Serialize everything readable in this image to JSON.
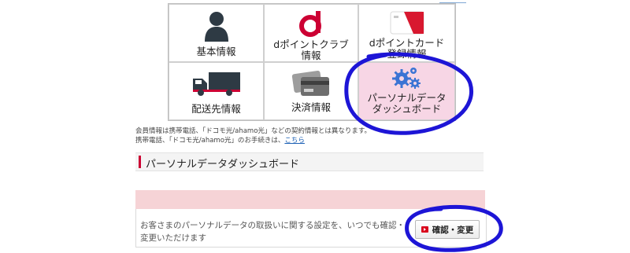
{
  "tiles": [
    {
      "label": "基本情報",
      "icon": "person-icon"
    },
    {
      "label": "dポイントクラブ\n情報",
      "icon": "d-logo-icon"
    },
    {
      "label": "dポイントカード\n登録情報",
      "icon": "card-icon"
    },
    {
      "label": "配送先情報",
      "icon": "truck-icon"
    },
    {
      "label": "決済情報",
      "icon": "payment-cards-icon"
    },
    {
      "label": "パーソナルデータ\nダッシュボード",
      "icon": "gears-icon",
      "selected": true
    }
  ],
  "notes": {
    "line1": "会員情報は携帯電話、「ドコモ光/ahamo光」などの契約情報とは異なります。",
    "line2_prefix": "携帯電話、「ドコモ光/ahamo光」のお手続きは、",
    "line2_link": "こちら"
  },
  "section": {
    "title": "パーソナルデータダッシュボード"
  },
  "info": {
    "text": "お客さまのパーソナルデータの取扱いに関する設定を、いつでも確認・変更いただけます",
    "button_label": "確認・変更"
  },
  "colors": {
    "accent_red": "#cc0033",
    "selected_tile_bg": "#f7d6e5",
    "annotation_blue": "#1d15d6",
    "gear_blue": "#3b74d4"
  }
}
